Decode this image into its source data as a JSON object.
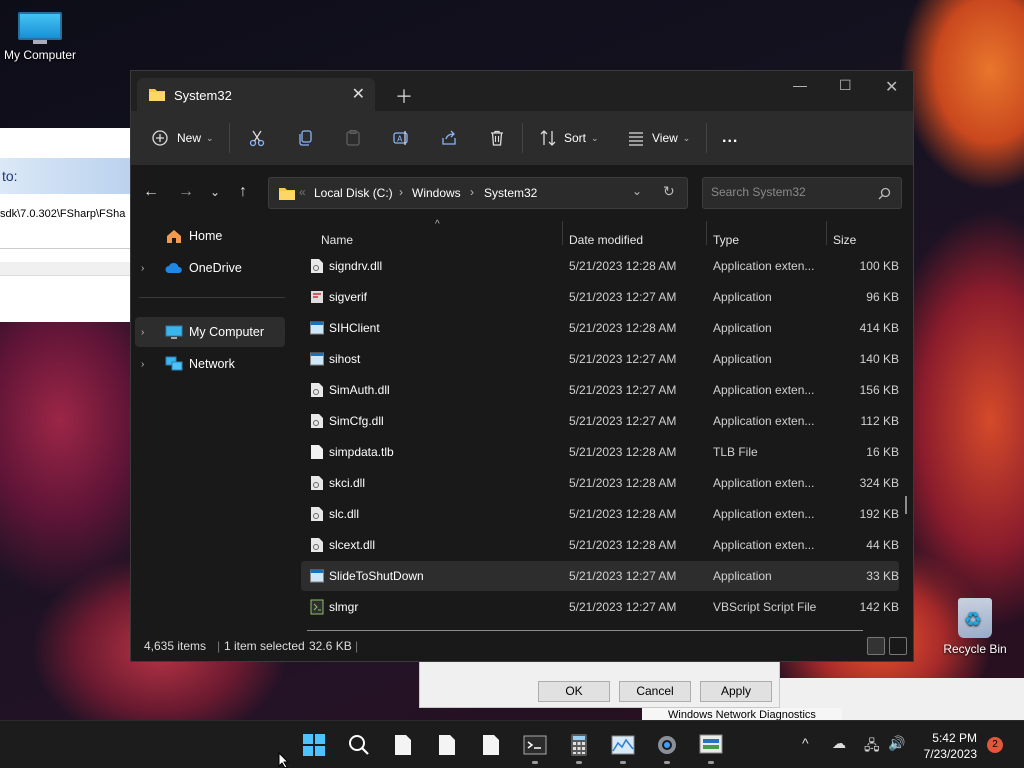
{
  "desktop": {
    "icons": [
      {
        "label": "My Computer"
      },
      {
        "label": "Recycle Bin"
      }
    ]
  },
  "background_dialog": {
    "header_text": "to:",
    "path_text": "sdk\\7.0.302\\FSharp\\FSha",
    "buttons": {
      "ok": "OK",
      "cancel": "Cancel",
      "apply": "Apply"
    },
    "behind_window_title": "Windows Network Diagnostics"
  },
  "explorer": {
    "tab": {
      "title": "System32"
    },
    "toolbar": {
      "new_label": "New",
      "sort_label": "Sort",
      "view_label": "View",
      "more_label": "..."
    },
    "breadcrumb": [
      "Local Disk (C:)",
      "Windows",
      "System32"
    ],
    "search": {
      "placeholder": "Search System32"
    },
    "nav": [
      {
        "label": "Home"
      },
      {
        "label": "OneDrive"
      },
      {
        "label": "My Computer"
      },
      {
        "label": "Network"
      }
    ],
    "columns": [
      "Name",
      "Date modified",
      "Type",
      "Size"
    ],
    "files": [
      {
        "name": "signdrv.dll",
        "date": "5/21/2023 12:28 AM",
        "type": "Application exten...",
        "size": "100 KB",
        "icon": "dll-file-icon"
      },
      {
        "name": "sigverif",
        "date": "5/21/2023 12:27 AM",
        "type": "Application",
        "size": "96 KB",
        "icon": "app-icon"
      },
      {
        "name": "SIHClient",
        "date": "5/21/2023 12:28 AM",
        "type": "Application",
        "size": "414 KB",
        "icon": "app-window-icon"
      },
      {
        "name": "sihost",
        "date": "5/21/2023 12:27 AM",
        "type": "Application",
        "size": "140 KB",
        "icon": "app-window-icon"
      },
      {
        "name": "SimAuth.dll",
        "date": "5/21/2023 12:27 AM",
        "type": "Application exten...",
        "size": "156 KB",
        "icon": "dll-file-icon"
      },
      {
        "name": "SimCfg.dll",
        "date": "5/21/2023 12:27 AM",
        "type": "Application exten...",
        "size": "112 KB",
        "icon": "dll-file-icon"
      },
      {
        "name": "simpdata.tlb",
        "date": "5/21/2023 12:28 AM",
        "type": "TLB File",
        "size": "16 KB",
        "icon": "blank-file-icon"
      },
      {
        "name": "skci.dll",
        "date": "5/21/2023 12:28 AM",
        "type": "Application exten...",
        "size": "324 KB",
        "icon": "dll-file-icon"
      },
      {
        "name": "slc.dll",
        "date": "5/21/2023 12:28 AM",
        "type": "Application exten...",
        "size": "192 KB",
        "icon": "dll-file-icon"
      },
      {
        "name": "slcext.dll",
        "date": "5/21/2023 12:28 AM",
        "type": "Application exten...",
        "size": "44 KB",
        "icon": "dll-file-icon"
      },
      {
        "name": "SlideToShutDown",
        "date": "5/21/2023 12:27 AM",
        "type": "Application",
        "size": "33 KB",
        "icon": "app-window-icon",
        "selected": true
      },
      {
        "name": "slmgr",
        "date": "5/21/2023 12:27 AM",
        "type": "VBScript Script File",
        "size": "142 KB",
        "icon": "script-file-icon"
      }
    ],
    "status": {
      "item_count": "4,635 items",
      "selection": "1 item selected",
      "selection_size": "32.6 KB"
    }
  },
  "taskbar": {
    "time": "5:42 PM",
    "date": "7/23/2023",
    "notification_count": "2"
  },
  "colors": {
    "window_bg": "#191919",
    "toolbar_bg": "#2c2c2c",
    "selection_bg": "#2d2d2d",
    "folder_yellow": "#f8c94a",
    "accent_blue": "#1fa8e6"
  }
}
